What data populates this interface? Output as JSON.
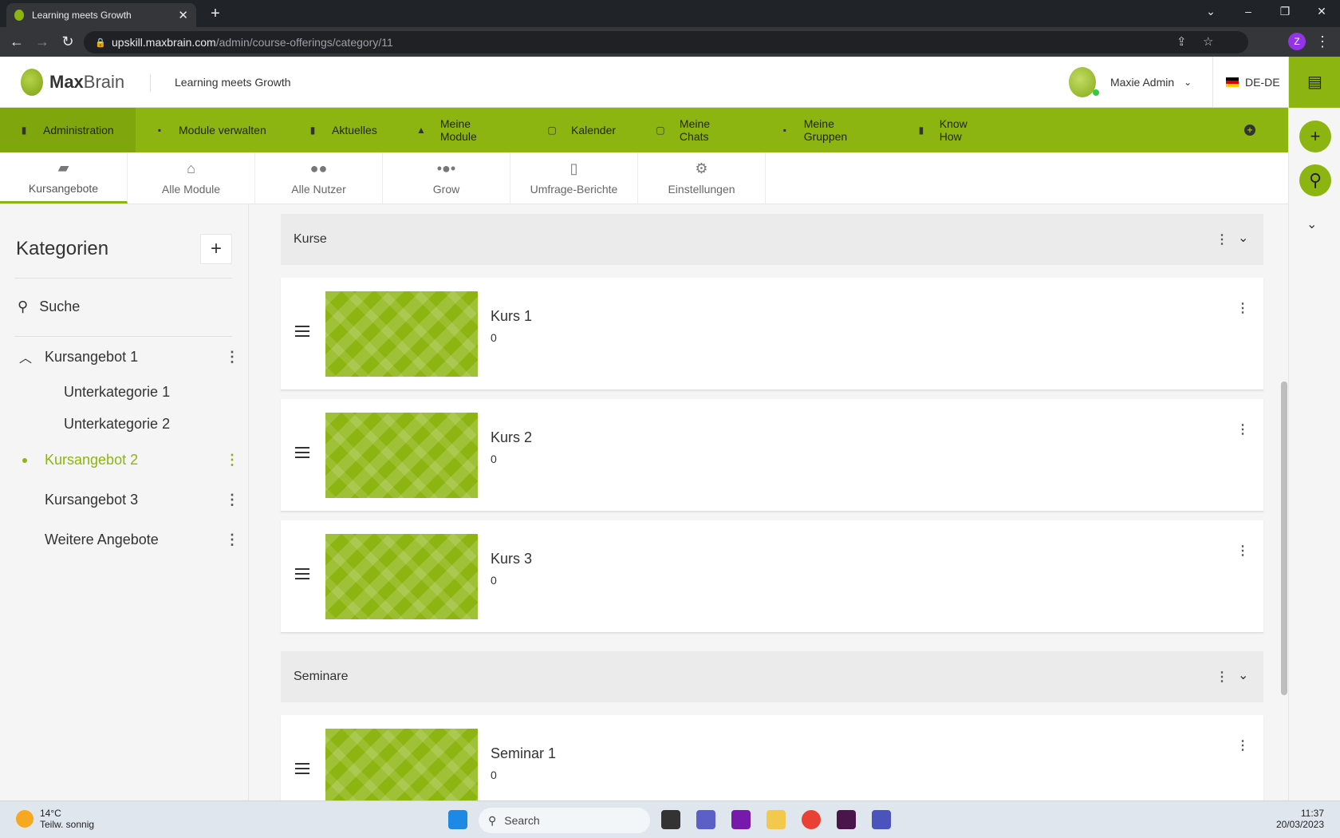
{
  "browser": {
    "tab_title": "Learning meets Growth",
    "tab_close": "✕",
    "new_tab": "+",
    "url_host": "upskill.maxbrain.com",
    "url_path": "/admin/course-offerings/category/11",
    "profile_initial": "Z"
  },
  "header": {
    "logo_bold": "Max",
    "logo_light": "Brain",
    "tagline": "Learning meets Growth",
    "user_name": "Maxie Admin",
    "language": "DE-DE"
  },
  "nav": [
    {
      "label": "Administration",
      "icon": "admin-icon"
    },
    {
      "label": "Module verwalten",
      "icon": "folder-icon"
    },
    {
      "label": "Aktuelles",
      "icon": "news-icon"
    },
    {
      "label": "Meine Module",
      "icon": "graduation-cap-icon"
    },
    {
      "label": "Kalender",
      "icon": "calendar-icon"
    },
    {
      "label": "Meine Chats",
      "icon": "chat-icon"
    },
    {
      "label": "Meine Gruppen",
      "icon": "group-folder-icon"
    },
    {
      "label": "Know How",
      "icon": "book-icon"
    }
  ],
  "subtabs": [
    {
      "label": "Kursangebote",
      "icon": "course-offering-icon"
    },
    {
      "label": "Alle Module",
      "icon": "institution-icon"
    },
    {
      "label": "Alle Nutzer",
      "icon": "users-icon"
    },
    {
      "label": "Grow",
      "icon": "groups-icon"
    },
    {
      "label": "Umfrage-Berichte",
      "icon": "report-icon"
    },
    {
      "label": "Einstellungen",
      "icon": "gears-icon"
    }
  ],
  "sidebar": {
    "title": "Kategorien",
    "search_label": "Suche",
    "categories": [
      {
        "label": "Kursangebot 1"
      },
      {
        "label": "Kursangebot 2"
      },
      {
        "label": "Kursangebot 3"
      },
      {
        "label": "Weitere Angebote"
      }
    ],
    "subcategories": [
      "Unterkategorie 1",
      "Unterkategorie 2"
    ]
  },
  "main": {
    "sections": [
      {
        "title": "Kurse"
      },
      {
        "title": "Seminare"
      }
    ],
    "cards": [
      {
        "title": "Kurs 1",
        "count": "0"
      },
      {
        "title": "Kurs 2",
        "count": "0"
      },
      {
        "title": "Kurs 3",
        "count": "0"
      },
      {
        "title": "Seminar 1",
        "count": "0"
      }
    ]
  },
  "taskbar": {
    "temp": "14°C",
    "weather": "Teilw. sonnig",
    "search": "Search",
    "time": "11:37",
    "date": "20/03/2023"
  },
  "colors": {
    "accent": "#8db511",
    "accent_dark": "#7fa60c"
  }
}
